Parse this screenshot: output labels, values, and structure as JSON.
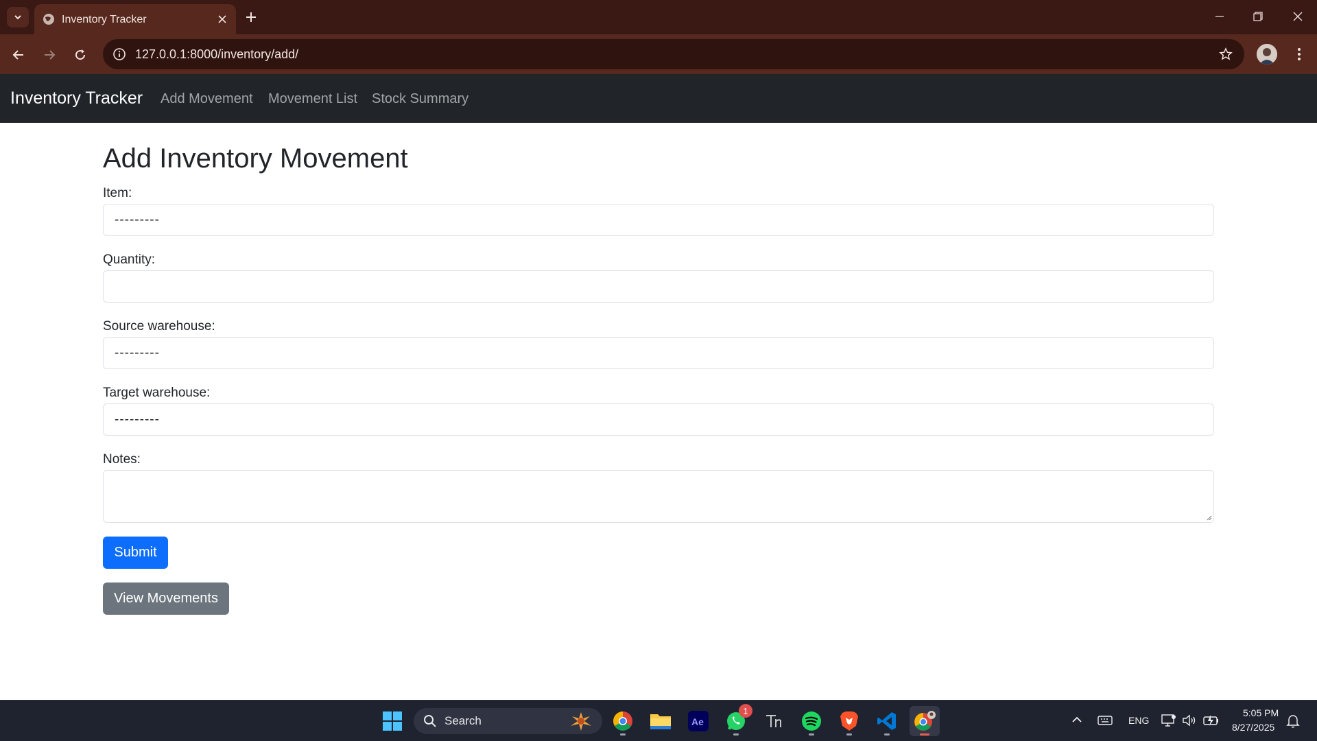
{
  "browser": {
    "tab_title": "Inventory Tracker",
    "url": "127.0.0.1:8000/inventory/add/"
  },
  "navbar": {
    "brand": "Inventory Tracker",
    "links": [
      "Add Movement",
      "Movement List",
      "Stock Summary"
    ]
  },
  "form": {
    "title": "Add Inventory Movement",
    "item_label": "Item:",
    "item_value": "---------",
    "quantity_label": "Quantity:",
    "quantity_value": "",
    "source_label": "Source warehouse:",
    "source_value": "---------",
    "target_label": "Target warehouse:",
    "target_value": "---------",
    "notes_label": "Notes:",
    "notes_value": "",
    "submit_label": "Submit",
    "view_label": "View Movements"
  },
  "taskbar": {
    "search_label": "Search",
    "whatsapp_badge": "1",
    "language": "ENG",
    "time": "5:05 PM",
    "date": "8/27/2025",
    "apps": [
      "chrome-icon",
      "file-explorer-icon",
      "after-effects-icon",
      "whatsapp-icon",
      "thorium-icon",
      "spotify-icon",
      "brave-icon",
      "vscode-icon",
      "chrome-profile-icon"
    ]
  },
  "colors": {
    "primary": "#0d6efd",
    "secondary": "#6c757d",
    "navbar_bg": "#212529",
    "chrome_bg": "#56281e"
  }
}
